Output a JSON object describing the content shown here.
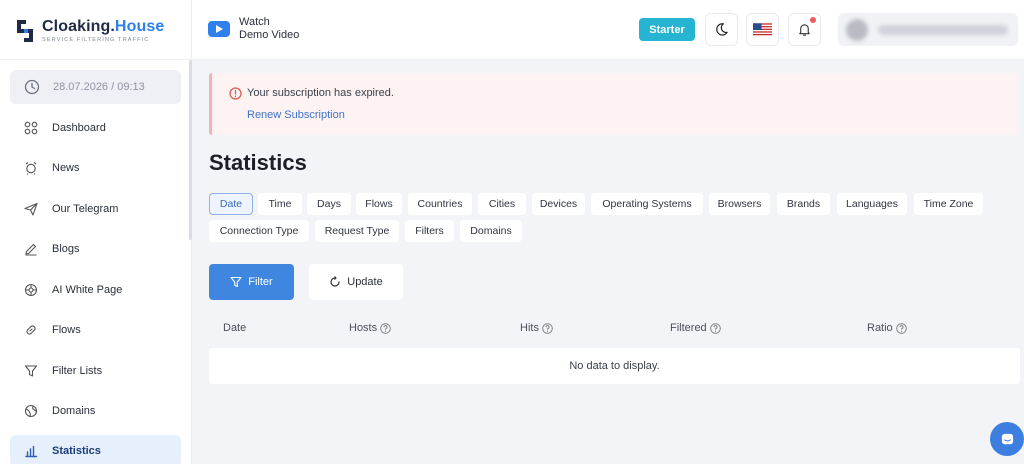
{
  "brand": {
    "name_part1": "Cloaking.",
    "name_part2": "House",
    "tagline": "SERVICE FILTERING TRAFFIC"
  },
  "sidebar": {
    "datetime": "28.07.2026 / 09:13",
    "items": [
      {
        "label": "Dashboard",
        "icon": "grid-icon"
      },
      {
        "label": "News",
        "icon": "news-icon"
      },
      {
        "label": "Our Telegram",
        "icon": "send-icon"
      },
      {
        "label": "Blogs",
        "icon": "pencil-icon"
      },
      {
        "label": "AI White Page",
        "icon": "ai-icon"
      },
      {
        "label": "Flows",
        "icon": "link-icon"
      },
      {
        "label": "Filter Lists",
        "icon": "filter-icon"
      },
      {
        "label": "Domains",
        "icon": "globe-icon"
      },
      {
        "label": "Statistics",
        "icon": "bar-chart-icon",
        "active": true
      }
    ]
  },
  "header": {
    "watch_line1": "Watch",
    "watch_line2": "Demo Video",
    "plan": "Starter"
  },
  "alert": {
    "message": "Your subscription has expired.",
    "link": "Renew Subscription"
  },
  "page": {
    "title": "Statistics",
    "tabs_row1": [
      "Date",
      "Time",
      "Days",
      "Flows",
      "Countries",
      "Cities",
      "Devices",
      "Operating Systems",
      "Browsers",
      "Brands",
      "Languages",
      "Time Zone"
    ],
    "tabs_row2": [
      "Connection Type",
      "Request Type",
      "Filters",
      "Domains"
    ],
    "active_tab": "Date",
    "filter_button": "Filter",
    "update_button": "Update"
  },
  "table": {
    "columns": [
      "Date",
      "Hosts",
      "Hits",
      "Filtered",
      "Ratio"
    ],
    "empty_text": "No data to display."
  },
  "colors": {
    "accent": "#3f86e0",
    "plan_badge": "#27b4d3",
    "alert_bg": "#fdf3f2",
    "active_nav_bg": "#e6effc"
  }
}
